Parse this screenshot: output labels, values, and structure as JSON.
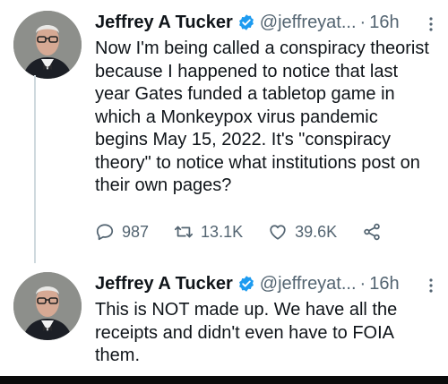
{
  "tweets": [
    {
      "author_name": "Jeffrey A Tucker",
      "handle": "@jeffreyat...",
      "separator": "·",
      "time": "16h",
      "text": "Now I'm being called a conspiracy theorist because I happened to notice that last year Gates funded a tabletop game in which a Monkeypox virus pandemic begins May 15, 2022. It's \"conspiracy theory\" to notice what institutions post on their own pages?",
      "replies": "987",
      "retweets": "13.1K",
      "likes": "39.6K"
    },
    {
      "author_name": "Jeffrey A Tucker",
      "handle": "@jeffreyat...",
      "separator": "·",
      "time": "16h",
      "text": "This is NOT made up. We have all the receipts and didn't even have to FOIA them."
    }
  ],
  "icons": {
    "verified": "verified-badge-icon",
    "more": "more-options-icon",
    "reply": "reply-icon",
    "retweet": "retweet-icon",
    "like": "heart-icon",
    "share": "share-icon"
  },
  "colors": {
    "verified_blue": "#1d9bf0",
    "secondary_text": "#536471",
    "primary_text": "#0f1419"
  }
}
